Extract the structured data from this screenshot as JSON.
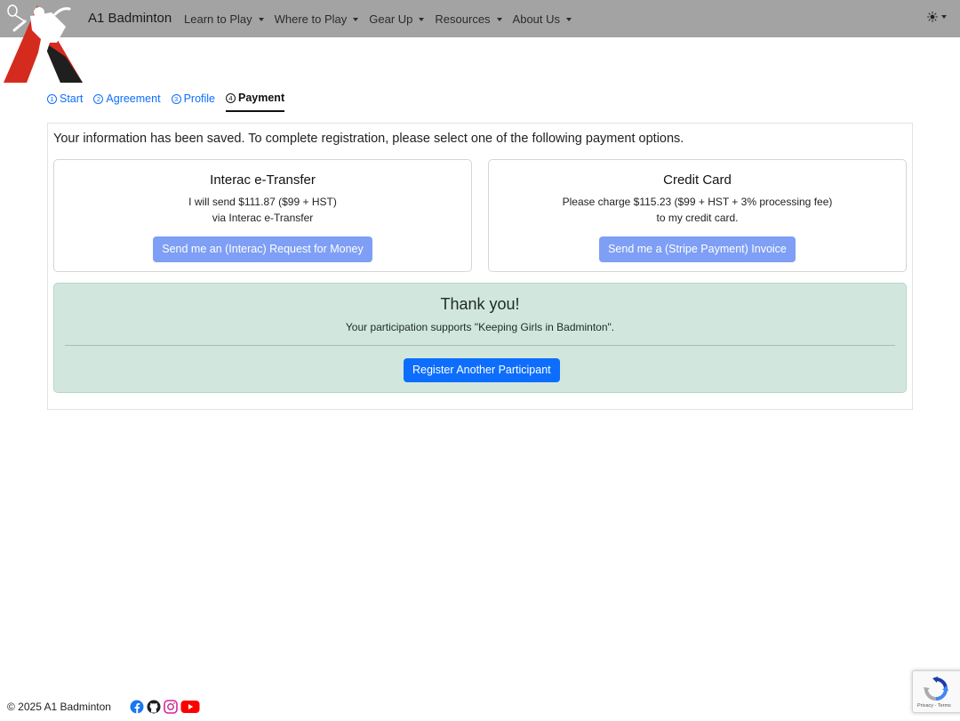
{
  "nav": {
    "brand": "A1 Badminton",
    "items": [
      {
        "label": "Learn to Play"
      },
      {
        "label": "Where to Play"
      },
      {
        "label": "Gear Up"
      },
      {
        "label": "Resources"
      },
      {
        "label": "About Us"
      }
    ]
  },
  "steps": [
    {
      "num": "1",
      "label": "Start"
    },
    {
      "num": "2",
      "label": "Agreement"
    },
    {
      "num": "3",
      "label": "Profile"
    },
    {
      "num": "4",
      "label": "Payment"
    }
  ],
  "intro": "Your information has been saved. To complete registration, please select one of the following payment options.",
  "interac": {
    "title": "Interac e-Transfer",
    "line1": "I will send $111.87 ($99 + HST)",
    "line2": "via Interac e-Transfer",
    "button": "Send me an (Interac) Request for Money"
  },
  "credit": {
    "title": "Credit Card",
    "line1": "Please charge $115.23 ($99 + HST + 3% processing fee)",
    "line2": "to my credit card.",
    "button": "Send me a (Stripe Payment) Invoice"
  },
  "thanks": {
    "title": "Thank you!",
    "text": "Your participation supports \"Keeping Girls in Badminton\".",
    "button": "Register Another Participant"
  },
  "footer": {
    "copyright": "© 2025 A1 Badminton"
  },
  "recaptcha": {
    "links": "Privacy - Terms"
  },
  "colors": {
    "navbar": "#a3a3a3",
    "primary": "#0d6efd",
    "primary_disabled": "#7e9ff5",
    "success_bg": "#d1e7dd",
    "logo_red": "#d52b1e",
    "facebook": "#1877f2",
    "youtube": "#ff0000"
  },
  "icons": {
    "theme": "sun-icon",
    "facebook": "facebook-icon",
    "github": "github-icon",
    "instagram": "instagram-icon",
    "youtube": "youtube-icon",
    "recaptcha": "recaptcha-icon"
  }
}
